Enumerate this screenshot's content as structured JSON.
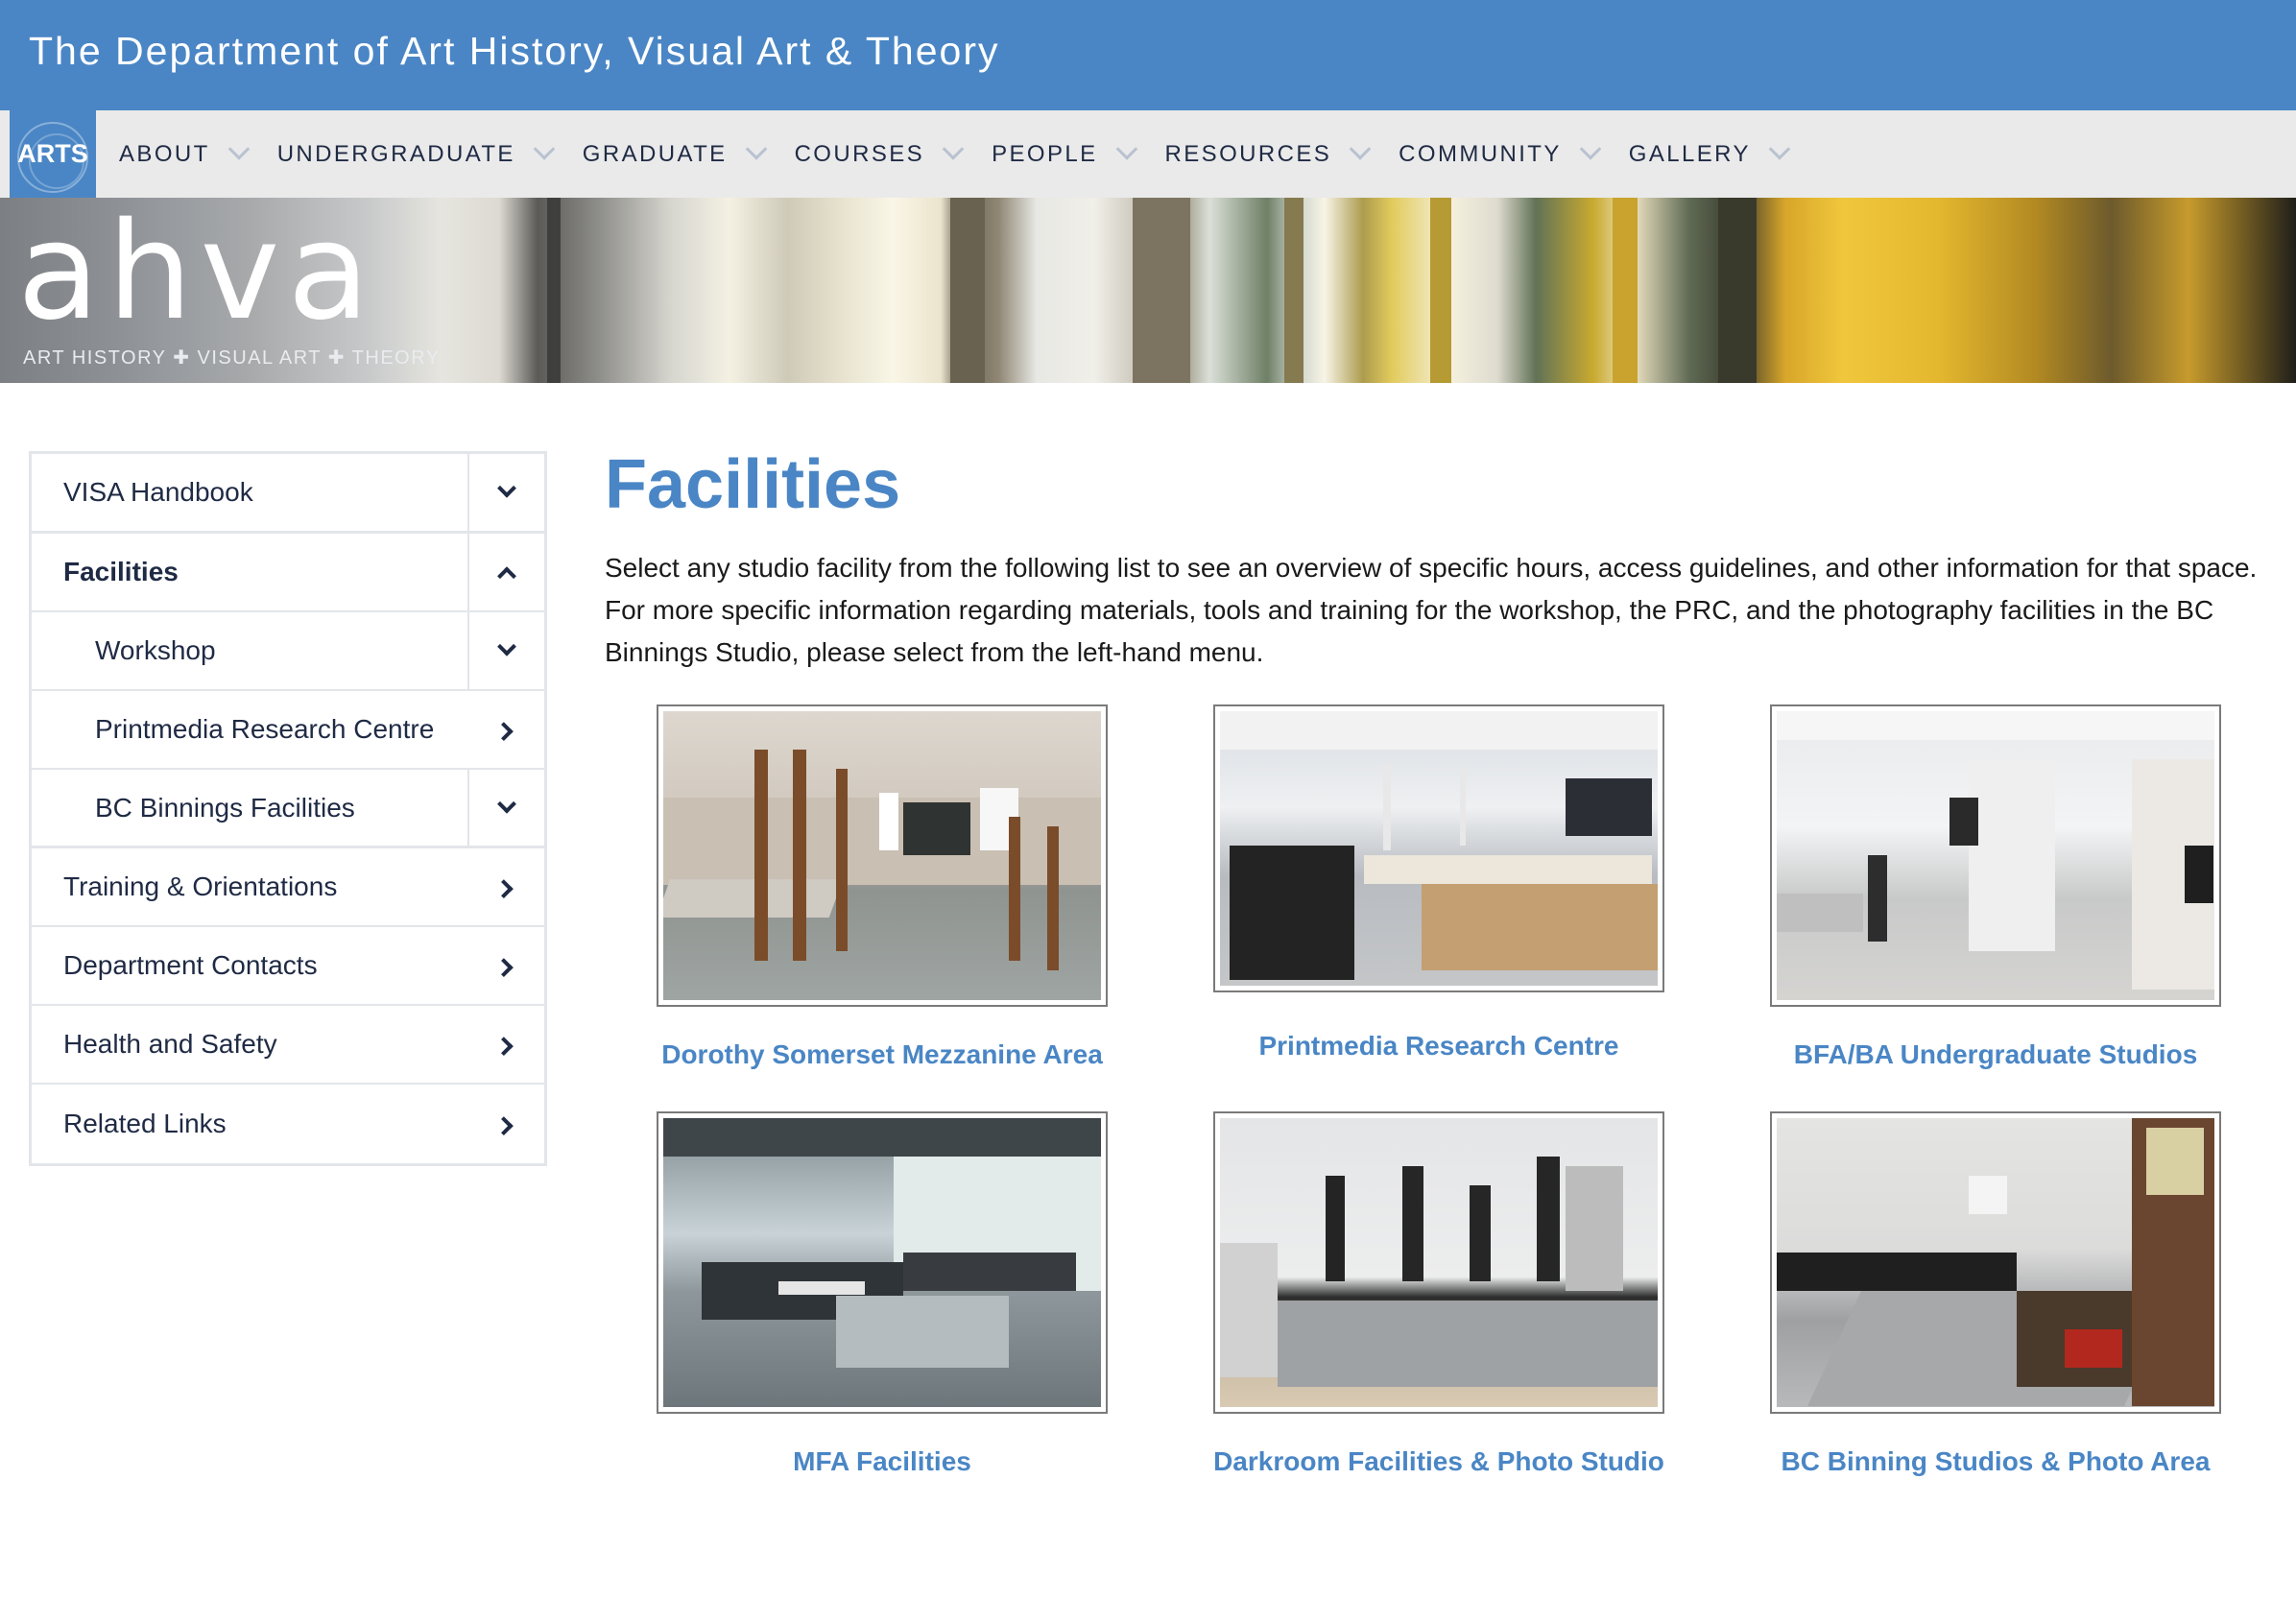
{
  "header": {
    "site_title": "The Department of Art History, Visual Art & Theory",
    "arts_logo": "ARTS"
  },
  "nav": {
    "items": [
      {
        "label": "ABOUT"
      },
      {
        "label": "UNDERGRADUATE"
      },
      {
        "label": "GRADUATE"
      },
      {
        "label": "COURSES"
      },
      {
        "label": "PEOPLE"
      },
      {
        "label": "RESOURCES"
      },
      {
        "label": "COMMUNITY"
      },
      {
        "label": "GALLERY"
      }
    ]
  },
  "banner": {
    "wordmark": "ahva",
    "tagline": "ART HISTORY ✚ VISUAL ART ✚ THEORY"
  },
  "sidebar": {
    "items": [
      {
        "label": "VISA Handbook",
        "toggle": "chevron-down"
      },
      {
        "label": "Facilities",
        "toggle": "chevron-up",
        "active": true
      },
      {
        "label": "Workshop",
        "toggle": "chevron-down",
        "sub": true
      },
      {
        "label": "Printmedia Research Centre",
        "toggle": "chevron-right",
        "sub": true
      },
      {
        "label": "BC Binnings Facilities",
        "toggle": "chevron-down",
        "sub": true
      },
      {
        "label": "Training & Orientations",
        "toggle": "chevron-right"
      },
      {
        "label": "Department Contacts",
        "toggle": "chevron-right"
      },
      {
        "label": "Health and Safety",
        "toggle": "chevron-right"
      },
      {
        "label": "Related Links",
        "toggle": "chevron-right"
      }
    ]
  },
  "main": {
    "title": "Facilities",
    "intro": "Select any studio facility from the following list to see an overview of specific hours, access guidelines, and other information for that space. For more specific information regarding materials, tools and training for the workshop, the PRC, and the photography facilities in the BC Binnings Studio, please select from the left-hand menu.",
    "facilities": [
      {
        "caption": "Dorothy Somerset Mezzanine Area"
      },
      {
        "caption": "Printmedia Research Centre"
      },
      {
        "caption": "BFA/BA Undergraduate Studios"
      },
      {
        "caption": "MFA Facilities"
      },
      {
        "caption": "Darkroom Facilities & Photo Studio"
      },
      {
        "caption": "BC Binning Studios & Photo Area"
      }
    ]
  },
  "colors": {
    "brand_blue": "#4a86c5",
    "nav_bg": "#eaeaea",
    "text_dark": "#1f2a44"
  }
}
